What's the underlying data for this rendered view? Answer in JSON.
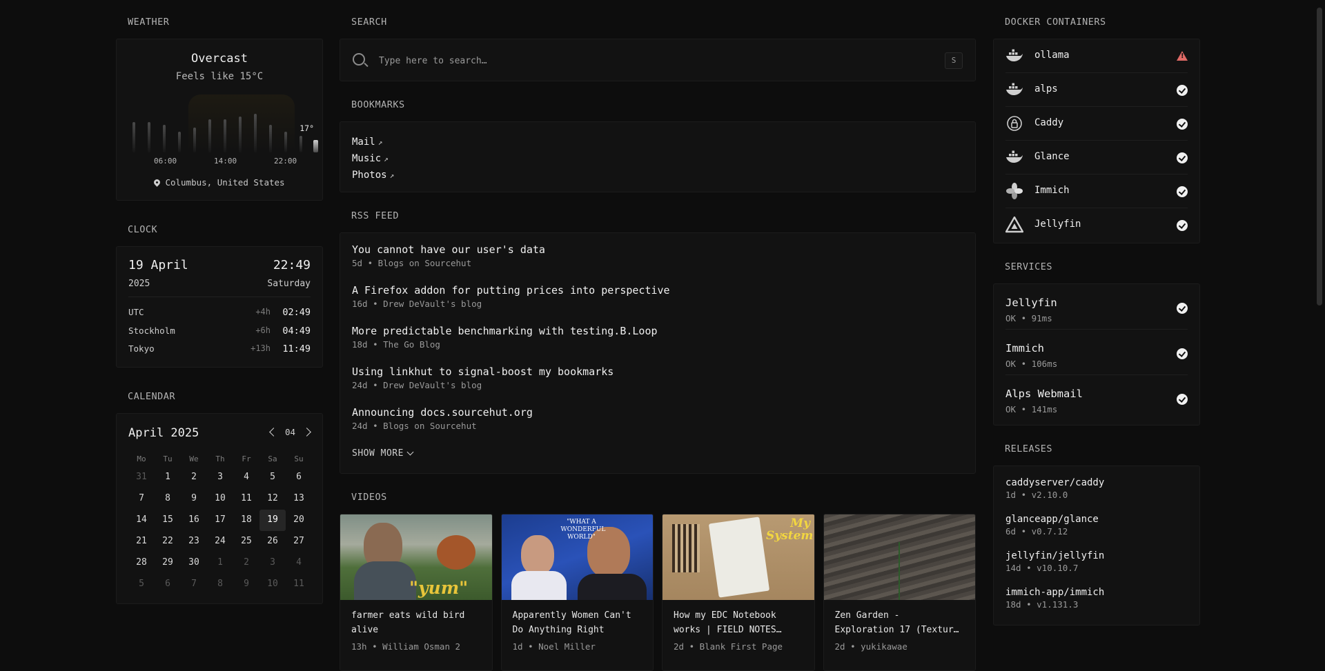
{
  "weather": {
    "header": "WEATHER",
    "condition": "Overcast",
    "feels_like": "Feels like 15°C",
    "current_temp": "17°",
    "ticks": [
      "06:00",
      "14:00",
      "22:00"
    ],
    "location": "Columbus, United States",
    "bar_levels": [
      0.55,
      0.55,
      0.5,
      0.38,
      0.45,
      0.6,
      0.6,
      0.65,
      0.7,
      0.5,
      0.38,
      0.3
    ]
  },
  "clock": {
    "header": "CLOCK",
    "date": "19 April",
    "year": "2025",
    "time": "22:49",
    "weekday": "Saturday",
    "timezones": [
      {
        "name": "UTC",
        "diff": "+4h",
        "time": "02:49"
      },
      {
        "name": "Stockholm",
        "diff": "+6h",
        "time": "04:49"
      },
      {
        "name": "Tokyo",
        "diff": "+13h",
        "time": "11:49"
      }
    ]
  },
  "calendar": {
    "header": "CALENDAR",
    "month": "April 2025",
    "month_num": "04",
    "weekdays": [
      "Mo",
      "Tu",
      "We",
      "Th",
      "Fr",
      "Sa",
      "Su"
    ],
    "days": [
      [
        "31",
        1
      ],
      [
        "1",
        0
      ],
      [
        "2",
        0
      ],
      [
        "3",
        0
      ],
      [
        "4",
        0
      ],
      [
        "5",
        0
      ],
      [
        "6",
        0
      ],
      [
        "7",
        0
      ],
      [
        "8",
        0
      ],
      [
        "9",
        0
      ],
      [
        "10",
        0
      ],
      [
        "11",
        0
      ],
      [
        "12",
        0
      ],
      [
        "13",
        0
      ],
      [
        "14",
        0
      ],
      [
        "15",
        0
      ],
      [
        "16",
        0
      ],
      [
        "17",
        0
      ],
      [
        "18",
        0
      ],
      [
        "19",
        2
      ],
      [
        "20",
        0
      ],
      [
        "21",
        0
      ],
      [
        "22",
        0
      ],
      [
        "23",
        0
      ],
      [
        "24",
        0
      ],
      [
        "25",
        0
      ],
      [
        "26",
        0
      ],
      [
        "27",
        0
      ],
      [
        "28",
        0
      ],
      [
        "29",
        0
      ],
      [
        "30",
        0
      ],
      [
        "1",
        1
      ],
      [
        "2",
        1
      ],
      [
        "3",
        1
      ],
      [
        "4",
        1
      ],
      [
        "5",
        1
      ],
      [
        "6",
        1
      ],
      [
        "7",
        1
      ],
      [
        "8",
        1
      ],
      [
        "9",
        1
      ],
      [
        "10",
        1
      ],
      [
        "11",
        1
      ]
    ]
  },
  "search": {
    "header": "SEARCH",
    "placeholder": "Type here to search…",
    "shortcut": "S"
  },
  "bookmarks": {
    "header": "BOOKMARKS",
    "items": [
      {
        "label": "Mail"
      },
      {
        "label": "Music"
      },
      {
        "label": "Photos"
      }
    ]
  },
  "rss": {
    "header": "RSS FEED",
    "items": [
      {
        "title": "You cannot have our user's data",
        "meta": "5d • Blogs on Sourcehut"
      },
      {
        "title": "A Firefox addon for putting prices into perspective",
        "meta": "16d • Drew DeVault's blog"
      },
      {
        "title": "More predictable benchmarking with testing.B.Loop",
        "meta": "18d • The Go Blog"
      },
      {
        "title": "Using linkhut to signal-boost my bookmarks",
        "meta": "24d • Drew DeVault's blog"
      },
      {
        "title": "Announcing docs.sourcehut.org",
        "meta": "24d • Blogs on Sourcehut"
      }
    ],
    "show_more": "SHOW MORE"
  },
  "videos": {
    "header": "VIDEOS",
    "items": [
      {
        "title": "farmer eats wild bird alive",
        "meta": "13h • William Osman 2",
        "thumb_text": "\"yum\""
      },
      {
        "title": "Apparently Women Can't Do Anything Right",
        "meta": "1d • Noel Miller",
        "thumb_text": "\"WHAT A WONDERFUL WORLD\""
      },
      {
        "title": "How my EDC Notebook works | FIELD NOTES…",
        "meta": "2d • Blank First Page",
        "thumb_text": "My System"
      },
      {
        "title": "Zen Garden - Exploration 17 (Textur…",
        "meta": "2d • yukikawae",
        "thumb_text": ""
      }
    ]
  },
  "docker": {
    "header": "DOCKER CONTAINERS",
    "items": [
      {
        "name": "ollama",
        "icon": "docker-icon",
        "status": "warn"
      },
      {
        "name": "alps",
        "icon": "docker-icon",
        "status": "ok"
      },
      {
        "name": "Caddy",
        "icon": "caddy-icon",
        "status": "ok"
      },
      {
        "name": "Glance",
        "icon": "docker-icon",
        "status": "ok"
      },
      {
        "name": "Immich",
        "icon": "immich-icon",
        "status": "ok"
      },
      {
        "name": "Jellyfin",
        "icon": "jellyfin-icon",
        "status": "ok"
      }
    ]
  },
  "services": {
    "header": "SERVICES",
    "items": [
      {
        "name": "Jellyfin",
        "meta": "OK • 91ms"
      },
      {
        "name": "Immich",
        "meta": "OK • 106ms"
      },
      {
        "name": "Alps Webmail",
        "meta": "OK • 141ms"
      }
    ]
  },
  "releases": {
    "header": "RELEASES",
    "items": [
      {
        "name": "caddyserver/caddy",
        "meta": "1d • v2.10.0"
      },
      {
        "name": "glanceapp/glance",
        "meta": "6d • v0.7.12"
      },
      {
        "name": "jellyfin/jellyfin",
        "meta": "14d • v10.10.7"
      },
      {
        "name": "immich-app/immich",
        "meta": "18d • v1.131.3"
      }
    ]
  },
  "colors": {
    "background": "#0d0d0d",
    "panel": "#121212",
    "warning": "#e06a66"
  }
}
